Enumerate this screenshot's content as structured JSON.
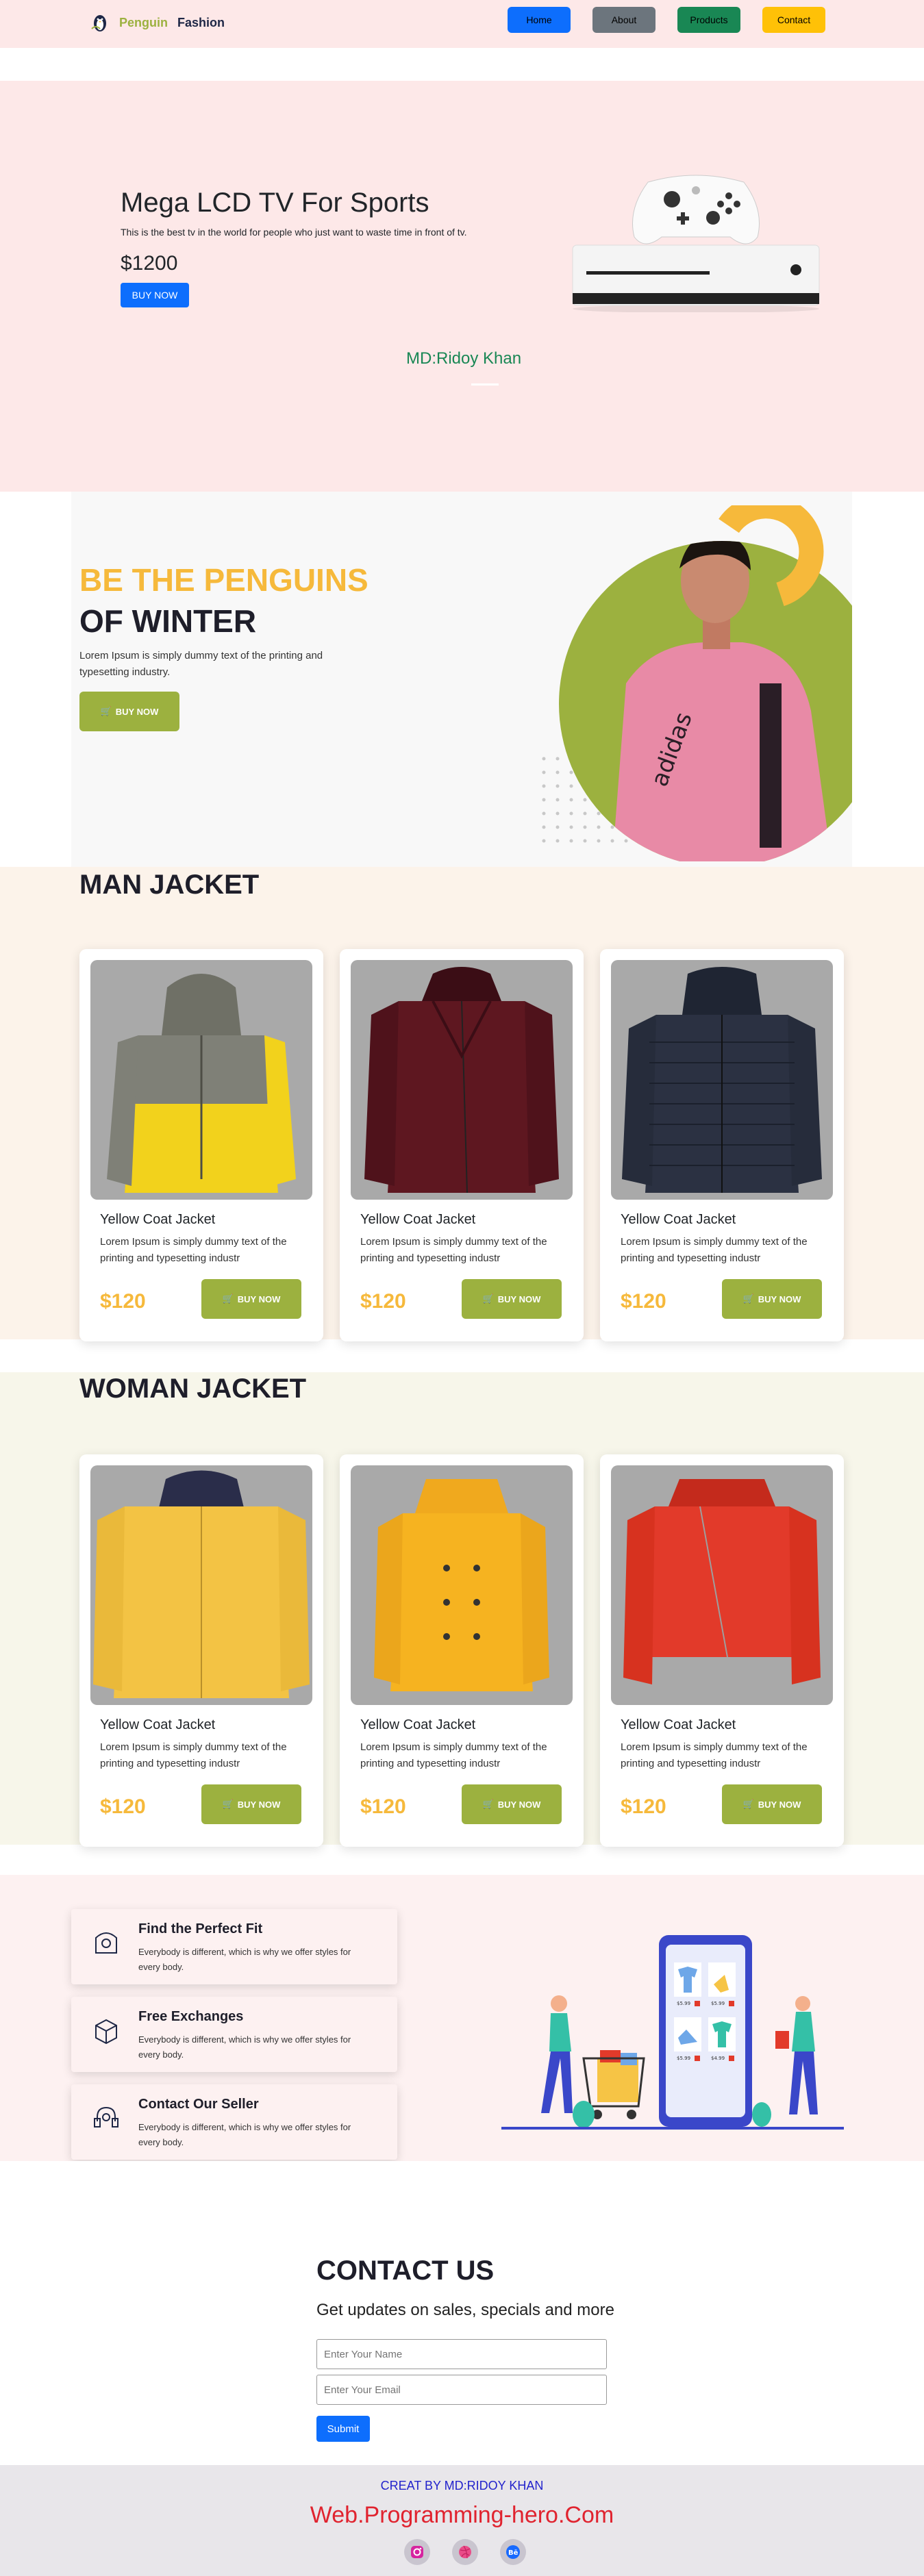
{
  "nav": {
    "brand_part1": "Penguin",
    "brand_part2": "Fashion",
    "links": [
      {
        "label": "Home",
        "color": "#0d6efd",
        "text_color": "#000000"
      },
      {
        "label": "About",
        "color": "#6c757d",
        "text_color": "#000000"
      },
      {
        "label": "Products",
        "color": "#198754",
        "text_color": "#000000"
      },
      {
        "label": "Contact",
        "color": "#ffc107",
        "text_color": "#000000"
      }
    ]
  },
  "hero": {
    "title": "Mega LCD TV For Sports",
    "description": "This is the best tv in the world for people who just want to waste time in front of tv.",
    "price": "$1200",
    "button": "BUY NOW",
    "author": "MD:Ridoy Khan"
  },
  "winter": {
    "line1": "BE THE PENGUINS",
    "line2": "OF WINTER",
    "text": "Lorem Ipsum is simply dummy text of the printing and typesetting industry.",
    "button": "BUY NOW",
    "shirt_text": "adidas"
  },
  "man": {
    "heading": "MAN JACKET",
    "cards": [
      {
        "title": "Yellow Coat Jacket",
        "text": "Lorem Ipsum is simply dummy text of the printing and typesetting industr",
        "price": "$120",
        "button": "BUY NOW"
      },
      {
        "title": "Yellow Coat Jacket",
        "text": "Lorem Ipsum is simply dummy text of the printing and typesetting industr",
        "price": "$120",
        "button": "BUY NOW"
      },
      {
        "title": "Yellow Coat Jacket",
        "text": "Lorem Ipsum is simply dummy text of the printing and typesetting industr",
        "price": "$120",
        "button": "BUY NOW"
      }
    ]
  },
  "woman": {
    "heading": "WOMAN JACKET",
    "cards": [
      {
        "title": "Yellow Coat Jacket",
        "text": "Lorem Ipsum is simply dummy text of the printing and typesetting industr",
        "price": "$120",
        "button": "BUY NOW"
      },
      {
        "title": "Yellow Coat Jacket",
        "text": "Lorem Ipsum is simply dummy text of the printing and typesetting industr",
        "price": "$120",
        "button": "BUY NOW"
      },
      {
        "title": "Yellow Coat Jacket",
        "text": "Lorem Ipsum is simply dummy text of the printing and typesetting industr",
        "price": "$120",
        "button": "BUY NOW"
      }
    ]
  },
  "features": [
    {
      "title": "Find the Perfect Fit",
      "text": "Everybody is different, which is why we offer styles for every body.",
      "icon": "hanger-icon"
    },
    {
      "title": "Free Exchanges",
      "text": "Everybody is different, which is why we offer styles for every body.",
      "icon": "box-icon"
    },
    {
      "title": "Contact Our Seller",
      "text": "Everybody is different, which is why we offer styles for every body.",
      "icon": "headset-icon"
    }
  ],
  "shop_prices": [
    "$5.99",
    "$5.99",
    "$5.99",
    "$4.99"
  ],
  "contact": {
    "heading": "CONTACT US",
    "subheading": "Get updates on sales, specials and more",
    "name_placeholder": "Enter Your Name",
    "email_placeholder": "Enter Your Email",
    "submit": "Submit"
  },
  "footer": {
    "credit": "CREAT BY MD:RIDOY KHAN",
    "site": "Web.Programming-hero.Com",
    "socials": [
      "instagram-icon",
      "dribbble-icon",
      "behance-icon"
    ],
    "behance_label": "Bē"
  },
  "colors": {
    "accent_green": "#9cb13f",
    "accent_yellow": "#f6b93b",
    "hero_bg": "#fde8e8"
  }
}
